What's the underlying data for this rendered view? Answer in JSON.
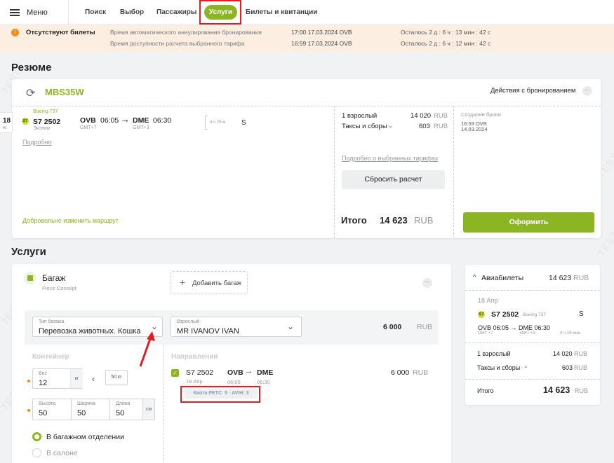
{
  "topbar": {
    "menu_label": "Меню",
    "tabs": [
      "Поиск",
      "Выбор",
      "Пассажиры",
      "Услуги",
      "Билеты и квитанции"
    ],
    "active_tab": "Услуги"
  },
  "alert": {
    "title": "Отсутствуют билеты",
    "rows": [
      {
        "label": "Время автоматического аннулирования бронирования",
        "value": "17:00 17.03.2024 OVB",
        "remaining": "Осталось 2 д : 6 ч : 13 мин : 42 с"
      },
      {
        "label": "Время доступности расчета выбранного тарифа",
        "value": "16:59 17.03.2024 OVB",
        "remaining": "Осталось 2 д : 6 ч : 12 мин : 42 с"
      }
    ]
  },
  "summary": {
    "heading": "Резюме",
    "pnr": "MBS35W",
    "actions_label": "Действия с бронированием",
    "flight": {
      "aircraft": "Boeing 737",
      "number": "S7 2502",
      "cabin": "Эконом",
      "from": "OVB",
      "dep_time": "06:05",
      "from_tz": "GMT+7",
      "to": "DME",
      "arr_time": "06:30",
      "to_tz": "GMT+3",
      "duration": "4 ч 25 м",
      "class": "S",
      "side_day": "18",
      "side_code": "AI"
    },
    "details_link": "Подробно",
    "change_route": "Добровольно изменить маршрут",
    "price": {
      "adult_label": "1 взрослый",
      "adult_value": "14 020",
      "taxes_label": "Таксы и сборы",
      "taxes_value": "603",
      "currency": "RUB",
      "tariff_link": "Подробно о выбранных тарифах",
      "reset_button": "Сбросить расчет",
      "total_label": "Итого",
      "total_value": "14 623",
      "total_currency": "RUB"
    },
    "booking": {
      "created_label": "Создание брони",
      "created_time": "16:59 OVB",
      "created_date": "14.03.2024",
      "submit_button": "Оформить"
    }
  },
  "services": {
    "heading": "Услуги",
    "baggage": {
      "title": "Багаж",
      "subtitle": "Piece Concept",
      "add_button": "Добавить багаж",
      "type_label": "Тип багажа",
      "type_value": "Перевозка животных. Кошка",
      "passenger_label": "Взрослый",
      "passenger_value": "MR IVANOV IVAN",
      "price": "6 000",
      "currency": "RUB",
      "container_title": "Контейнер",
      "weight_label": "Вес",
      "weight_value": "12",
      "weight_unit": "кг",
      "max_weight": "50 кг",
      "height_label": "Высота",
      "height_value": "50",
      "width_label": "Ширина",
      "width_value": "50",
      "length_label": "Длина",
      "length_value": "50",
      "size_unit": "см",
      "radio_hold": "В багажном отделении",
      "radio_cabin": "В салоне",
      "directions_title": "Направления",
      "segment_flight": "S7 2502",
      "segment_date": "18 Апр",
      "segment_from": "OVB",
      "segment_to": "DME",
      "segment_dep": "06:05",
      "segment_arr": "06:30",
      "segment_price": "6 000",
      "quota": "Квота PETC: 5 · AVIH: 3"
    }
  },
  "side_panel": {
    "title": "Авиабилеты",
    "total": "14 623",
    "currency": "RUB",
    "date": "18 Апр",
    "flight_number": "S7 2502",
    "aircraft": "· Boeing 737",
    "class": "S",
    "route": "OVB 06:05 → DME 06:30",
    "from_tz": "GMT +7",
    "to_tz": "GMT +3",
    "duration": "4 ч 25 мин",
    "adult_label": "1 взрослый",
    "adult_value": "14 020",
    "taxes_label": "Таксы и сборы",
    "taxes_value": "603",
    "total_label": "Итого"
  },
  "watermark": "TEST",
  "colors": {
    "accent": "#8cb524",
    "alert_bg": "#fcefe2",
    "warning": "#f08a1c",
    "highlight": "#e01e24"
  }
}
